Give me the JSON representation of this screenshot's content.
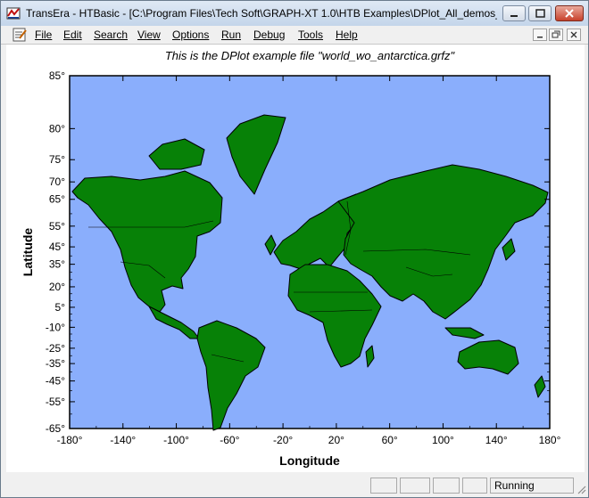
{
  "window": {
    "title": "TransEra - HTBasic - [C:\\Program Files\\Tech Soft\\GRAPH-XT 1.0\\HTB Examples\\DPlot_All_demos_..."
  },
  "menu": {
    "items": [
      "File",
      "Edit",
      "Search",
      "View",
      "Options",
      "Run",
      "Debug",
      "Tools",
      "Help"
    ]
  },
  "chart_data": {
    "type": "map",
    "title": "This is the DPlot example file \"world_wo_antarctica.grfz\"",
    "xlabel": "Longitude",
    "ylabel": "Latitude",
    "xlim": [
      -180,
      180
    ],
    "x_ticks": [
      "-180°",
      "-140°",
      "-100°",
      "-60°",
      "-20°",
      "20°",
      "60°",
      "100°",
      "140°",
      "180°"
    ],
    "y_ticks": [
      "85°",
      "80°",
      "75°",
      "70°",
      "65°",
      "55°",
      "45°",
      "35°",
      "20°",
      "5°",
      "-10°",
      "-25°",
      "-35°",
      "-45°",
      "-55°",
      "-65°"
    ],
    "ocean_color": "#8aaefc",
    "land_color": "#078107"
  },
  "status": {
    "text": "Running"
  }
}
